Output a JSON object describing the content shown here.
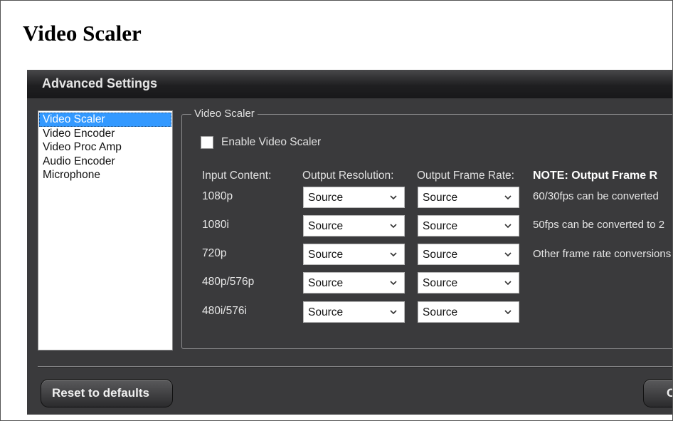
{
  "page": {
    "title": "Video Scaler"
  },
  "window": {
    "title": "Advanced Settings"
  },
  "nav": {
    "items": [
      {
        "label": "Video Scaler",
        "selected": true
      },
      {
        "label": "Video Encoder",
        "selected": false
      },
      {
        "label": "Video Proc Amp",
        "selected": false
      },
      {
        "label": "Audio Encoder",
        "selected": false
      },
      {
        "label": "Microphone",
        "selected": false
      }
    ]
  },
  "group": {
    "legend": "Video Scaler",
    "enable": {
      "label": "Enable Video Scaler",
      "checked": false
    },
    "headers": {
      "input": "Input Content:",
      "resolution": "Output Resolution:",
      "framerate": "Output Frame Rate:",
      "note": "NOTE: Output Frame R"
    },
    "rows": [
      {
        "input": "1080p",
        "resolution": "Source",
        "framerate": "Source"
      },
      {
        "input": "1080i",
        "resolution": "Source",
        "framerate": "Source"
      },
      {
        "input": "720p",
        "resolution": "Source",
        "framerate": "Source"
      },
      {
        "input": "480p/576p",
        "resolution": "Source",
        "framerate": "Source"
      },
      {
        "input": "480i/576i",
        "resolution": "Source",
        "framerate": "Source"
      }
    ],
    "notes": [
      "60/30fps can be converted",
      "50fps can be converted to 2",
      "Other frame rate conversions"
    ]
  },
  "buttons": {
    "reset": "Reset to defaults",
    "ok": "C"
  },
  "icons": {
    "select_arrow": "chevron-down-icon"
  },
  "colors": {
    "selection": "#3399ff",
    "window_bg": "#3a3a3c"
  }
}
